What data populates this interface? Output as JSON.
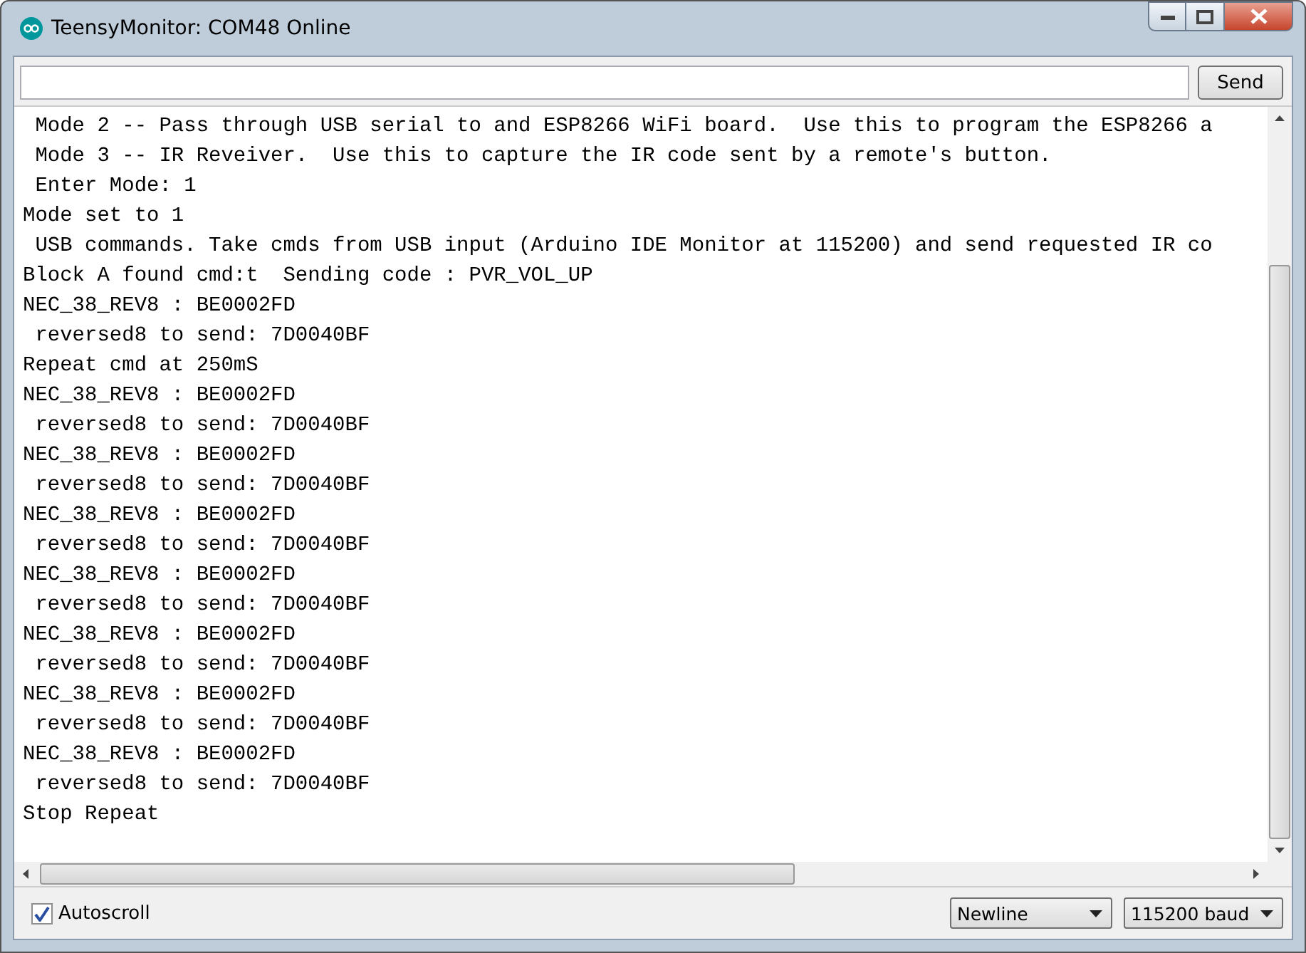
{
  "window": {
    "title": "TeensyMonitor: COM48 Online"
  },
  "send_button": "Send",
  "output_lines": [
    " Mode 2 -- Pass through USB serial to and ESP8266 WiFi board.  Use this to program the ESP8266 a",
    " Mode 3 -- IR Reveiver.  Use this to capture the IR code sent by a remote's button.",
    " Enter Mode: 1",
    "Mode set to 1",
    " USB commands. Take cmds from USB input (Arduino IDE Monitor at 115200) and send requested IR co",
    "Block A found cmd:t  Sending code : PVR_VOL_UP",
    "NEC_38_REV8 : BE0002FD",
    " reversed8 to send: 7D0040BF",
    "Repeat cmd at 250mS",
    "NEC_38_REV8 : BE0002FD",
    " reversed8 to send: 7D0040BF",
    "NEC_38_REV8 : BE0002FD",
    " reversed8 to send: 7D0040BF",
    "NEC_38_REV8 : BE0002FD",
    " reversed8 to send: 7D0040BF",
    "NEC_38_REV8 : BE0002FD",
    " reversed8 to send: 7D0040BF",
    "NEC_38_REV8 : BE0002FD",
    " reversed8 to send: 7D0040BF",
    "NEC_38_REV8 : BE0002FD",
    " reversed8 to send: 7D0040BF",
    "NEC_38_REV8 : BE0002FD",
    " reversed8 to send: 7D0040BF",
    "Stop Repeat"
  ],
  "autoscroll": {
    "label": "Autoscroll",
    "checked": true
  },
  "line_ending": "Newline",
  "baud_rate": "115200 baud"
}
